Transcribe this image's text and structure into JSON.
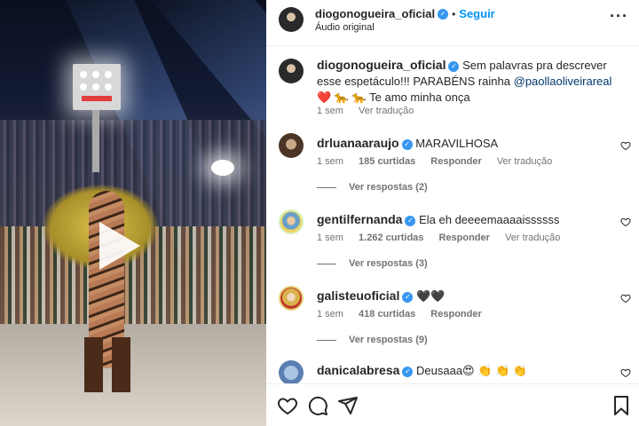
{
  "header": {
    "username": "diogonogueira_oficial",
    "separator": "•",
    "follow_label": "Seguir",
    "audio_label": "Áudio original",
    "more_icon": "more-horizontal-icon"
  },
  "caption": {
    "username": "diogonogueira_oficial",
    "text_1": "Sem palavras pra descrever esse espetáculo!!! PARABÉNS rainha",
    "mention": "@paollaoliveirareal",
    "text_2": "❤️ 🐆 🐆 Te amo minha onça",
    "time": "1 sem",
    "translate": "Ver tradução"
  },
  "comments": [
    {
      "username": "drluanaaraujo",
      "text": "MARAVILHOSA",
      "time": "1 sem",
      "likes": "185 curtidas",
      "reply": "Responder",
      "translate": "Ver tradução",
      "view_replies": "Ver respostas (2)"
    },
    {
      "username": "gentilfernanda",
      "text": "Ela eh deeeemaaaaissssss",
      "time": "1 sem",
      "likes": "1.262 curtidas",
      "reply": "Responder",
      "translate": "Ver tradução",
      "view_replies": "Ver respostas (3)"
    },
    {
      "username": "galisteuoficial",
      "text": "🖤🖤",
      "time": "1 sem",
      "likes": "418 curtidas",
      "reply": "Responder",
      "view_replies": "Ver respostas (9)"
    },
    {
      "username": "danicalabresa",
      "text": "Deusaaa😍 👏 👏 👏"
    }
  ],
  "footer": {
    "icons": [
      "heart-icon",
      "comment-icon",
      "share-icon",
      "bookmark-icon"
    ]
  },
  "colors": {
    "link_blue": "#0095f6",
    "verified_blue": "#3797f0",
    "muted": "#737373",
    "text": "#262626"
  }
}
